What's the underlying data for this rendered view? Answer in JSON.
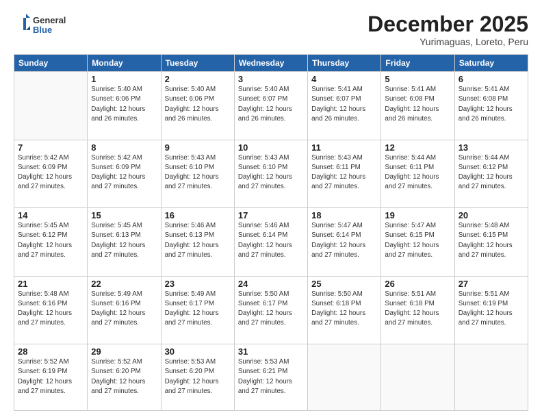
{
  "logo": {
    "general": "General",
    "blue": "Blue"
  },
  "header": {
    "month": "December 2025",
    "location": "Yurimaguas, Loreto, Peru"
  },
  "weekdays": [
    "Sunday",
    "Monday",
    "Tuesday",
    "Wednesday",
    "Thursday",
    "Friday",
    "Saturday"
  ],
  "weeks": [
    [
      {
        "day": "",
        "info": ""
      },
      {
        "day": "1",
        "info": "Sunrise: 5:40 AM\nSunset: 6:06 PM\nDaylight: 12 hours\nand 26 minutes."
      },
      {
        "day": "2",
        "info": "Sunrise: 5:40 AM\nSunset: 6:06 PM\nDaylight: 12 hours\nand 26 minutes."
      },
      {
        "day": "3",
        "info": "Sunrise: 5:40 AM\nSunset: 6:07 PM\nDaylight: 12 hours\nand 26 minutes."
      },
      {
        "day": "4",
        "info": "Sunrise: 5:41 AM\nSunset: 6:07 PM\nDaylight: 12 hours\nand 26 minutes."
      },
      {
        "day": "5",
        "info": "Sunrise: 5:41 AM\nSunset: 6:08 PM\nDaylight: 12 hours\nand 26 minutes."
      },
      {
        "day": "6",
        "info": "Sunrise: 5:41 AM\nSunset: 6:08 PM\nDaylight: 12 hours\nand 26 minutes."
      }
    ],
    [
      {
        "day": "7",
        "info": "Sunrise: 5:42 AM\nSunset: 6:09 PM\nDaylight: 12 hours\nand 27 minutes."
      },
      {
        "day": "8",
        "info": "Sunrise: 5:42 AM\nSunset: 6:09 PM\nDaylight: 12 hours\nand 27 minutes."
      },
      {
        "day": "9",
        "info": "Sunrise: 5:43 AM\nSunset: 6:10 PM\nDaylight: 12 hours\nand 27 minutes."
      },
      {
        "day": "10",
        "info": "Sunrise: 5:43 AM\nSunset: 6:10 PM\nDaylight: 12 hours\nand 27 minutes."
      },
      {
        "day": "11",
        "info": "Sunrise: 5:43 AM\nSunset: 6:11 PM\nDaylight: 12 hours\nand 27 minutes."
      },
      {
        "day": "12",
        "info": "Sunrise: 5:44 AM\nSunset: 6:11 PM\nDaylight: 12 hours\nand 27 minutes."
      },
      {
        "day": "13",
        "info": "Sunrise: 5:44 AM\nSunset: 6:12 PM\nDaylight: 12 hours\nand 27 minutes."
      }
    ],
    [
      {
        "day": "14",
        "info": "Sunrise: 5:45 AM\nSunset: 6:12 PM\nDaylight: 12 hours\nand 27 minutes."
      },
      {
        "day": "15",
        "info": "Sunrise: 5:45 AM\nSunset: 6:13 PM\nDaylight: 12 hours\nand 27 minutes."
      },
      {
        "day": "16",
        "info": "Sunrise: 5:46 AM\nSunset: 6:13 PM\nDaylight: 12 hours\nand 27 minutes."
      },
      {
        "day": "17",
        "info": "Sunrise: 5:46 AM\nSunset: 6:14 PM\nDaylight: 12 hours\nand 27 minutes."
      },
      {
        "day": "18",
        "info": "Sunrise: 5:47 AM\nSunset: 6:14 PM\nDaylight: 12 hours\nand 27 minutes."
      },
      {
        "day": "19",
        "info": "Sunrise: 5:47 AM\nSunset: 6:15 PM\nDaylight: 12 hours\nand 27 minutes."
      },
      {
        "day": "20",
        "info": "Sunrise: 5:48 AM\nSunset: 6:15 PM\nDaylight: 12 hours\nand 27 minutes."
      }
    ],
    [
      {
        "day": "21",
        "info": "Sunrise: 5:48 AM\nSunset: 6:16 PM\nDaylight: 12 hours\nand 27 minutes."
      },
      {
        "day": "22",
        "info": "Sunrise: 5:49 AM\nSunset: 6:16 PM\nDaylight: 12 hours\nand 27 minutes."
      },
      {
        "day": "23",
        "info": "Sunrise: 5:49 AM\nSunset: 6:17 PM\nDaylight: 12 hours\nand 27 minutes."
      },
      {
        "day": "24",
        "info": "Sunrise: 5:50 AM\nSunset: 6:17 PM\nDaylight: 12 hours\nand 27 minutes."
      },
      {
        "day": "25",
        "info": "Sunrise: 5:50 AM\nSunset: 6:18 PM\nDaylight: 12 hours\nand 27 minutes."
      },
      {
        "day": "26",
        "info": "Sunrise: 5:51 AM\nSunset: 6:18 PM\nDaylight: 12 hours\nand 27 minutes."
      },
      {
        "day": "27",
        "info": "Sunrise: 5:51 AM\nSunset: 6:19 PM\nDaylight: 12 hours\nand 27 minutes."
      }
    ],
    [
      {
        "day": "28",
        "info": "Sunrise: 5:52 AM\nSunset: 6:19 PM\nDaylight: 12 hours\nand 27 minutes."
      },
      {
        "day": "29",
        "info": "Sunrise: 5:52 AM\nSunset: 6:20 PM\nDaylight: 12 hours\nand 27 minutes."
      },
      {
        "day": "30",
        "info": "Sunrise: 5:53 AM\nSunset: 6:20 PM\nDaylight: 12 hours\nand 27 minutes."
      },
      {
        "day": "31",
        "info": "Sunrise: 5:53 AM\nSunset: 6:21 PM\nDaylight: 12 hours\nand 27 minutes."
      },
      {
        "day": "",
        "info": ""
      },
      {
        "day": "",
        "info": ""
      },
      {
        "day": "",
        "info": ""
      }
    ]
  ]
}
